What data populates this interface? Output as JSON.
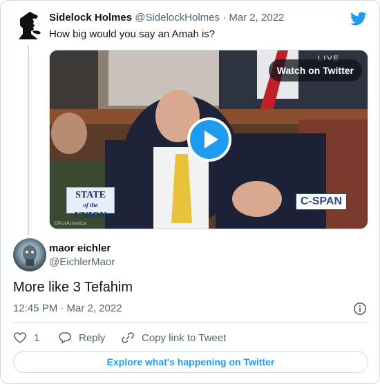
{
  "parent_tweet": {
    "author_name": "Sidelock Holmes",
    "handle": "@SidelockHolmes",
    "separator": "·",
    "date": "Mar 2, 2022",
    "text": "How big would you say an Amah is?",
    "avatar_icon": "sherlock-silhouette-icon",
    "media": {
      "watch_label": "Watch on Twitter",
      "live_label": "LIVE",
      "overlay_left": [
        "STATE",
        "of the",
        "UNION"
      ],
      "overlay_right": "C-SPAN",
      "watermark": "©ForAmerica",
      "play_icon": "play-icon"
    }
  },
  "reply_tweet": {
    "author_name": "maor eichler",
    "handle": "@EichlerMaor",
    "text": "More like 3 Tefahim",
    "timestamp": "12:45 PM · Mar 2, 2022",
    "info_icon": "info-icon"
  },
  "actions": {
    "like_count": "1",
    "reply_label": "Reply",
    "copy_label": "Copy link to Tweet"
  },
  "footer": {
    "explore_label": "Explore what's happening on Twitter"
  },
  "colors": {
    "brand_blue": "#1d9bf0",
    "text_primary": "#0f1419",
    "text_secondary": "#536471",
    "border": "#cfd9de"
  }
}
